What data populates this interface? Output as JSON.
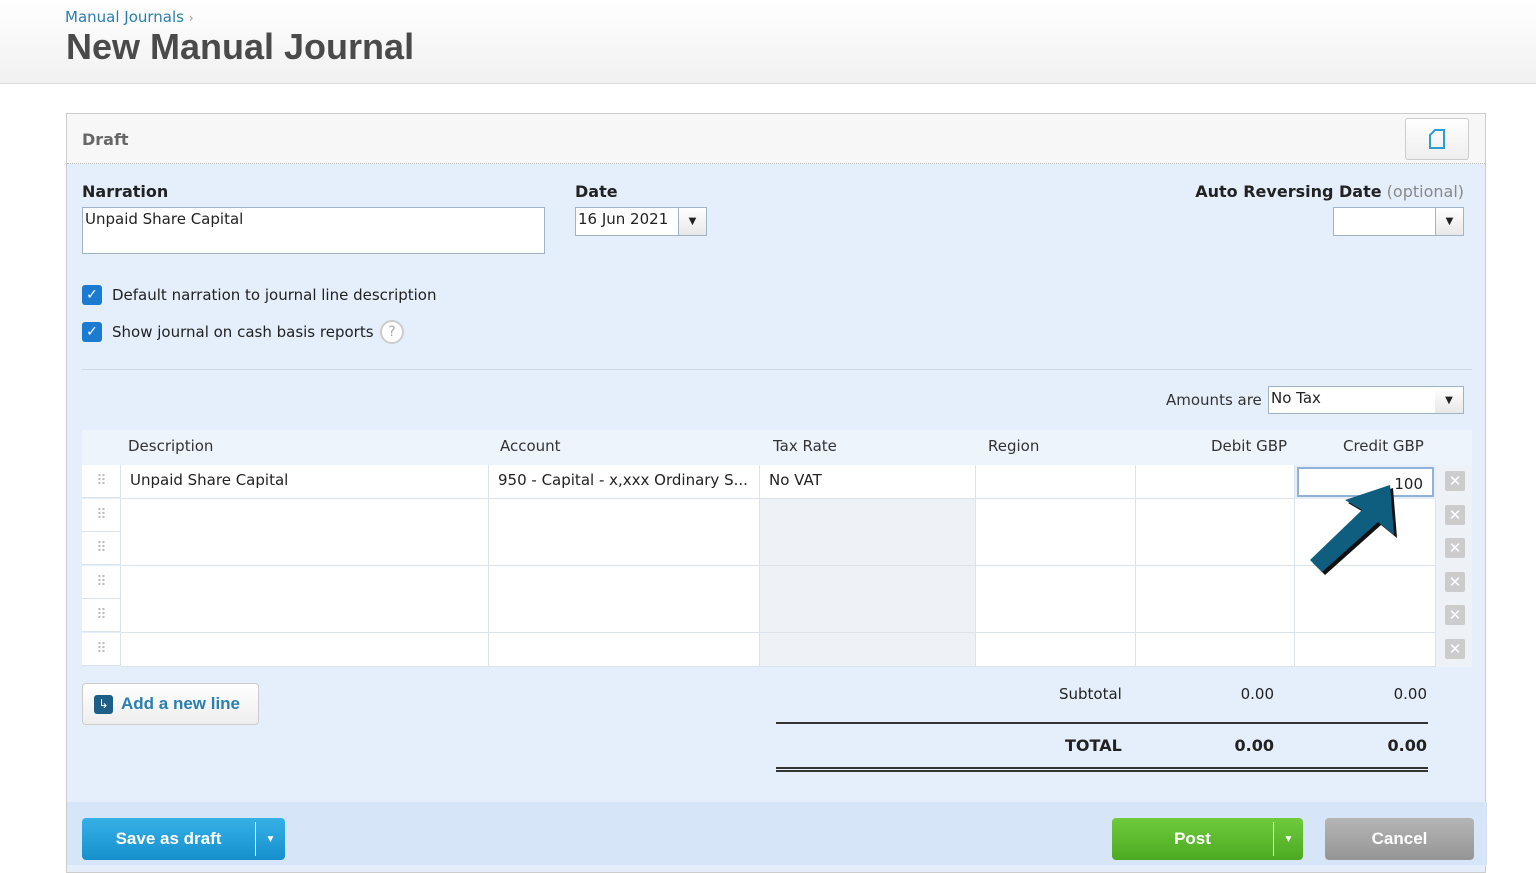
{
  "header": {
    "breadcrumb": "Manual Journals",
    "breadcrumb_sep": "›",
    "title": "New Manual Journal"
  },
  "status": "Draft",
  "form": {
    "narration_label": "Narration",
    "narration_value": "Unpaid Share Capital",
    "date_label": "Date",
    "date_value": "16 Jun 2021",
    "auto_rev_label": "Auto Reversing Date",
    "auto_rev_optional": "(optional)",
    "auto_rev_value": "",
    "chk_default_narration": {
      "label": "Default narration to journal line description",
      "checked": true
    },
    "chk_cash_basis": {
      "label": "Show journal on cash basis reports",
      "checked": true
    },
    "help": "?",
    "amounts_label": "Amounts are",
    "amounts_value": "No Tax"
  },
  "table": {
    "headers": [
      "Description",
      "Account",
      "Tax Rate",
      "Region",
      "Debit GBP",
      "Credit GBP"
    ],
    "rows": [
      [
        "Unpaid Share Capital",
        "950 - Capital - x,xxx Ordinary S...",
        "No VAT",
        "",
        "",
        "100"
      ],
      [
        "",
        "",
        "",
        "",
        "",
        ""
      ],
      [
        "",
        "",
        "",
        "",
        "",
        ""
      ],
      [
        "",
        "",
        "",
        "",
        "",
        ""
      ],
      [
        "",
        "",
        "",
        "",
        "",
        ""
      ],
      [
        "",
        "",
        "",
        "",
        "",
        ""
      ]
    ]
  },
  "add_line": "Add a new line",
  "totals": {
    "subtotal_label": "Subtotal",
    "subtotal_debit": "0.00",
    "subtotal_credit": "0.00",
    "total_label": "TOTAL",
    "total_debit": "0.00",
    "total_credit": "0.00"
  },
  "buttons": {
    "save_draft": "Save as draft",
    "post": "Post",
    "cancel": "Cancel"
  },
  "colors": {
    "link": "#2a7fb0",
    "save": "#1e9ad6",
    "post": "#5cb82e",
    "cancel": "#999999",
    "arrow": "#0f5e80"
  }
}
